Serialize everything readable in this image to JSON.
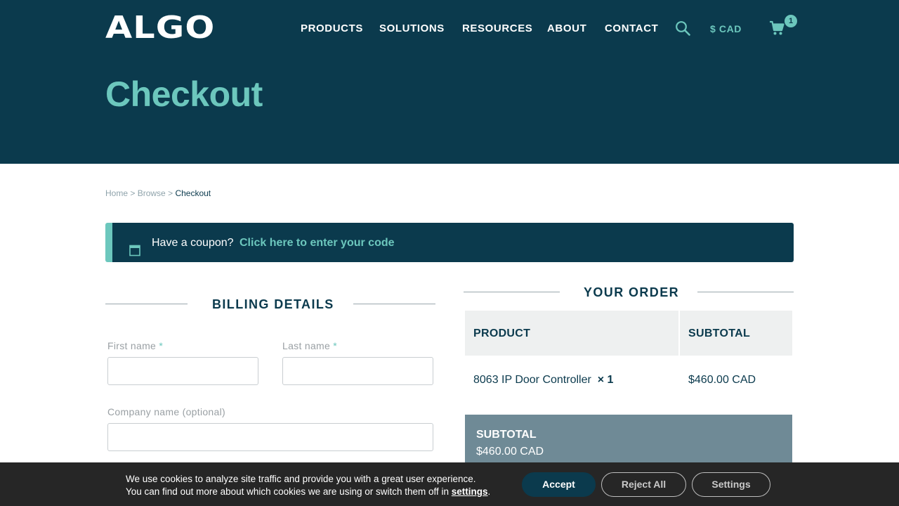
{
  "header": {
    "logo": "ALGO",
    "nav": [
      "PRODUCTS",
      "SOLUTIONS",
      "RESOURCES",
      "ABOUT",
      "CONTACT"
    ],
    "currency": "$ CAD",
    "cart_count": "1",
    "page_title": "Checkout"
  },
  "breadcrumb": {
    "items": [
      "Home",
      "Browse",
      "Checkout"
    ],
    "separator": ">"
  },
  "coupon": {
    "prompt": "Have a coupon?",
    "link": "Click here to enter your code"
  },
  "billing": {
    "heading": "BILLING DETAILS",
    "first_name_label": "First name",
    "last_name_label": "Last name",
    "company_label": "Company name (optional)",
    "required_marker": "*",
    "first_name_value": "",
    "last_name_value": "",
    "company_value": ""
  },
  "order": {
    "heading": "YOUR ORDER",
    "columns": [
      "PRODUCT",
      "SUBTOTAL"
    ],
    "items": [
      {
        "name": "8063 IP Door Controller",
        "qty": "× 1",
        "subtotal": "$460.00 CAD"
      }
    ],
    "subtotal_label": "SUBTOTAL",
    "subtotal_value": "$460.00 CAD"
  },
  "cookie_banner": {
    "line1": "We use cookies to analyze site traffic and provide you with a great user experience.",
    "line2_prefix": "You can find out more about which cookies we are using or switch them off in",
    "settings_link": "settings",
    "line2_suffix": ".",
    "accept": "Accept",
    "reject": "Reject All",
    "settings": "Settings"
  },
  "colors": {
    "brand_dark": "#0b3a4d",
    "accent": "#6cc7bd",
    "table_header": "#eef0f0",
    "subtotal_box": "#6f8a96",
    "cookie_bg": "#262626"
  },
  "icons": [
    "search-icon",
    "cart-icon",
    "coupon-icon"
  ]
}
